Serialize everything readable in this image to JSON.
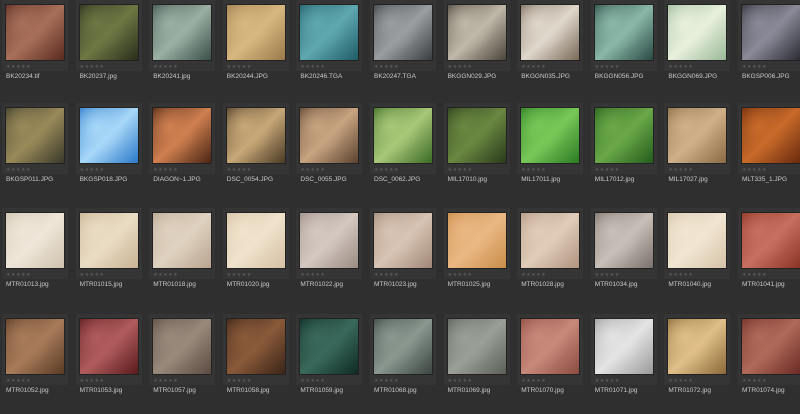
{
  "browser": {
    "rating_glyph": "★★★★★",
    "items": [
      {
        "name": "BK20234.tif",
        "c1": "#5a2a20",
        "c2": "#a8705a"
      },
      {
        "name": "BK20237.jpg",
        "c1": "#2a2e1c",
        "c2": "#6d7844"
      },
      {
        "name": "BK20241.jpg",
        "c1": "#3a5048",
        "c2": "#9bb0a4"
      },
      {
        "name": "BK20244.JPG",
        "c1": "#9a7a4a",
        "c2": "#d8b880"
      },
      {
        "name": "BK20246.TGA",
        "c1": "#1f5c66",
        "c2": "#5fa8b0"
      },
      {
        "name": "BK20247.TGA",
        "c1": "#3a3e40",
        "c2": "#9a9ea0"
      },
      {
        "name": "BKGGN029.JPG",
        "c1": "#4a443a",
        "c2": "#c0b8a8"
      },
      {
        "name": "BKGGN035.JPG",
        "c1": "#7a6a5a",
        "c2": "#e0d8cc"
      },
      {
        "name": "BKGGN056.JPG",
        "c1": "#2a4a44",
        "c2": "#8ab8a8"
      },
      {
        "name": "BKGGN069.JPG",
        "c1": "#9ab898",
        "c2": "#e8f0dc"
      },
      {
        "name": "BKGSP006.JPG",
        "c1": "#2c2c34",
        "c2": "#8a8a98"
      },
      {
        "name": "BKGSP011.JPG",
        "c1": "#3a3a2a",
        "c2": "#9a8a5a"
      },
      {
        "name": "BKGSP018.JPG",
        "c1": "#2a78c8",
        "c2": "#a8d8f8"
      },
      {
        "name": "DIAGON~1.JPG",
        "c1": "#4a2414",
        "c2": "#d08050"
      },
      {
        "name": "DSC_0054.JPG",
        "c1": "#4a3a24",
        "c2": "#c8a878"
      },
      {
        "name": "DSC_0055.JPG",
        "c1": "#5a4230",
        "c2": "#c8a480"
      },
      {
        "name": "DSC_0062.JPG",
        "c1": "#3a6a24",
        "c2": "#a8c878"
      },
      {
        "name": "MIL17010.jpg",
        "c1": "#2a3a1c",
        "c2": "#6a8840"
      },
      {
        "name": "MIL17011.jpg",
        "c1": "#2a7a24",
        "c2": "#78c858"
      },
      {
        "name": "MIL17012.jpg",
        "c1": "#245c1c",
        "c2": "#6aa848"
      },
      {
        "name": "MIL17027.jpg",
        "c1": "#8a6a44",
        "c2": "#d0b088"
      },
      {
        "name": "MLT335_1.JPG",
        "c1": "#6a2a0c",
        "c2": "#c86a2a"
      },
      {
        "name": "MTR01013.jpg",
        "c1": "#cfc2ae",
        "c2": "#eee6d8"
      },
      {
        "name": "MTR01015.jpg",
        "c1": "#c8b294",
        "c2": "#eadcc4"
      },
      {
        "name": "MTR01018.jpg",
        "c1": "#b8a490",
        "c2": "#e0d2c0"
      },
      {
        "name": "MTR01020.jpg",
        "c1": "#d4c0a4",
        "c2": "#f0e2cc"
      },
      {
        "name": "MTR01022.jpg",
        "c1": "#9a8a82",
        "c2": "#d4c8c0"
      },
      {
        "name": "MTR01023.jpg",
        "c1": "#a08878",
        "c2": "#d8c4b4"
      },
      {
        "name": "MTR01025.jpg",
        "c1": "#c88c48",
        "c2": "#eab884"
      },
      {
        "name": "MTR01028.jpg",
        "c1": "#b09480",
        "c2": "#e0ccb8"
      },
      {
        "name": "MTR01034.jpg",
        "c1": "#7a706c",
        "c2": "#c8c0b8"
      },
      {
        "name": "MTR01040.jpg",
        "c1": "#d4c2a8",
        "c2": "#f2e6d2"
      },
      {
        "name": "MTR01041.jpg",
        "c1": "#8a3424",
        "c2": "#c87060"
      },
      {
        "name": "MTR01052.jpg",
        "c1": "#5a3a24",
        "c2": "#a87c5a"
      },
      {
        "name": "MTR01053.jpg",
        "c1": "#5a1a1c",
        "c2": "#b05c5c"
      },
      {
        "name": "MTR01057.jpg",
        "c1": "#5a4a40",
        "c2": "#9a8a7c"
      },
      {
        "name": "MTR01058.jpg",
        "c1": "#3a2418",
        "c2": "#8a5a3a"
      },
      {
        "name": "MTR01059.jpg",
        "c1": "#0e2a24",
        "c2": "#3a6a5c"
      },
      {
        "name": "MTR01068.jpg",
        "c1": "#3a4440",
        "c2": "#8a9890"
      },
      {
        "name": "MTR01069.jpg",
        "c1": "#5a6058",
        "c2": "#9aa098"
      },
      {
        "name": "MTR01070.jpg",
        "c1": "#8a4a40",
        "c2": "#c8887a"
      },
      {
        "name": "MTR01071.jpg",
        "c1": "#9a9a9a",
        "c2": "#e4e4e4"
      },
      {
        "name": "MTR01072.jpg",
        "c1": "#8a6838",
        "c2": "#e0c088"
      },
      {
        "name": "MTR01074.jpg",
        "c1": "#6a2a24",
        "c2": "#b06a5a"
      }
    ]
  }
}
